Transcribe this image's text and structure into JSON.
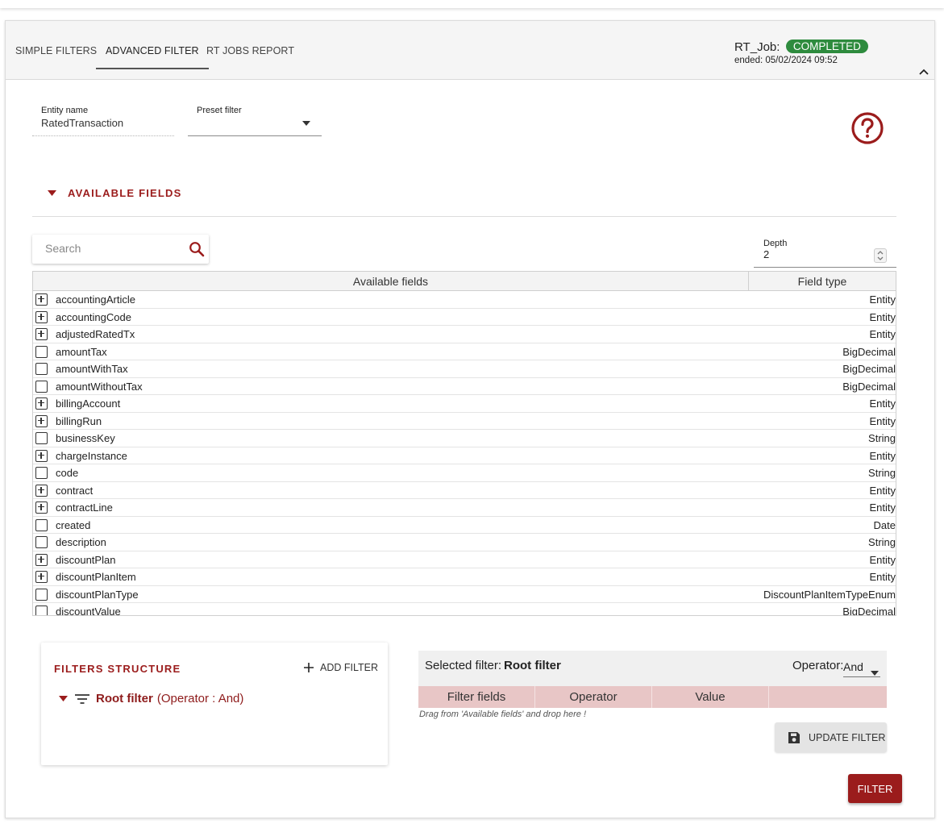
{
  "tabs": [
    {
      "label": "SIMPLE FILTERS"
    },
    {
      "label": "ADVANCED FILTER"
    },
    {
      "label": "RT JOBS REPORT"
    }
  ],
  "job": {
    "title": "RT_Job:",
    "status": "COMPLETED",
    "status_color": "#2e8b3e",
    "ended": "ended: 05/02/2024 09:52"
  },
  "entity": {
    "label": "Entity name",
    "value": "RatedTransaction"
  },
  "preset": {
    "label": "Preset filter",
    "value": ""
  },
  "available": {
    "title": "AVAILABLE FIELDS",
    "search_placeholder": "Search",
    "depth_label": "Depth",
    "depth_value": "2",
    "columns": [
      "Available fields",
      "Field type"
    ],
    "rows": [
      {
        "name": "accountingArticle",
        "type": "Entity",
        "expandable": true
      },
      {
        "name": "accountingCode",
        "type": "Entity",
        "expandable": true
      },
      {
        "name": "adjustedRatedTx",
        "type": "Entity",
        "expandable": true
      },
      {
        "name": "amountTax",
        "type": "BigDecimal",
        "expandable": false
      },
      {
        "name": "amountWithTax",
        "type": "BigDecimal",
        "expandable": false
      },
      {
        "name": "amountWithoutTax",
        "type": "BigDecimal",
        "expandable": false
      },
      {
        "name": "billingAccount",
        "type": "Entity",
        "expandable": true
      },
      {
        "name": "billingRun",
        "type": "Entity",
        "expandable": true
      },
      {
        "name": "businessKey",
        "type": "String",
        "expandable": false
      },
      {
        "name": "chargeInstance",
        "type": "Entity",
        "expandable": true
      },
      {
        "name": "code",
        "type": "String",
        "expandable": false
      },
      {
        "name": "contract",
        "type": "Entity",
        "expandable": true
      },
      {
        "name": "contractLine",
        "type": "Entity",
        "expandable": true
      },
      {
        "name": "created",
        "type": "Date",
        "expandable": false
      },
      {
        "name": "description",
        "type": "String",
        "expandable": false
      },
      {
        "name": "discountPlan",
        "type": "Entity",
        "expandable": true
      },
      {
        "name": "discountPlanItem",
        "type": "Entity",
        "expandable": true
      },
      {
        "name": "discountPlanType",
        "type": "DiscountPlanItemTypeEnum",
        "expandable": false
      },
      {
        "name": "discountValue",
        "type": "BigDecimal",
        "expandable": false
      }
    ]
  },
  "filters_structure": {
    "title": "FILTERS STRUCTURE",
    "add_label": "ADD FILTER",
    "root_name": "Root filter",
    "root_operator": "(Operator : And)"
  },
  "selected": {
    "label": "Selected filter:",
    "name": "Root filter",
    "operator_label": "Operator:",
    "operator_value": "And",
    "columns": [
      "Filter fields",
      "Operator",
      "Value",
      ""
    ],
    "drag_hint": "Drag from 'Available fields' and drop here !",
    "update_label": "UPDATE FILTER"
  },
  "filter_button": "FILTER",
  "colors": {
    "accent": "#9b1c1c"
  }
}
